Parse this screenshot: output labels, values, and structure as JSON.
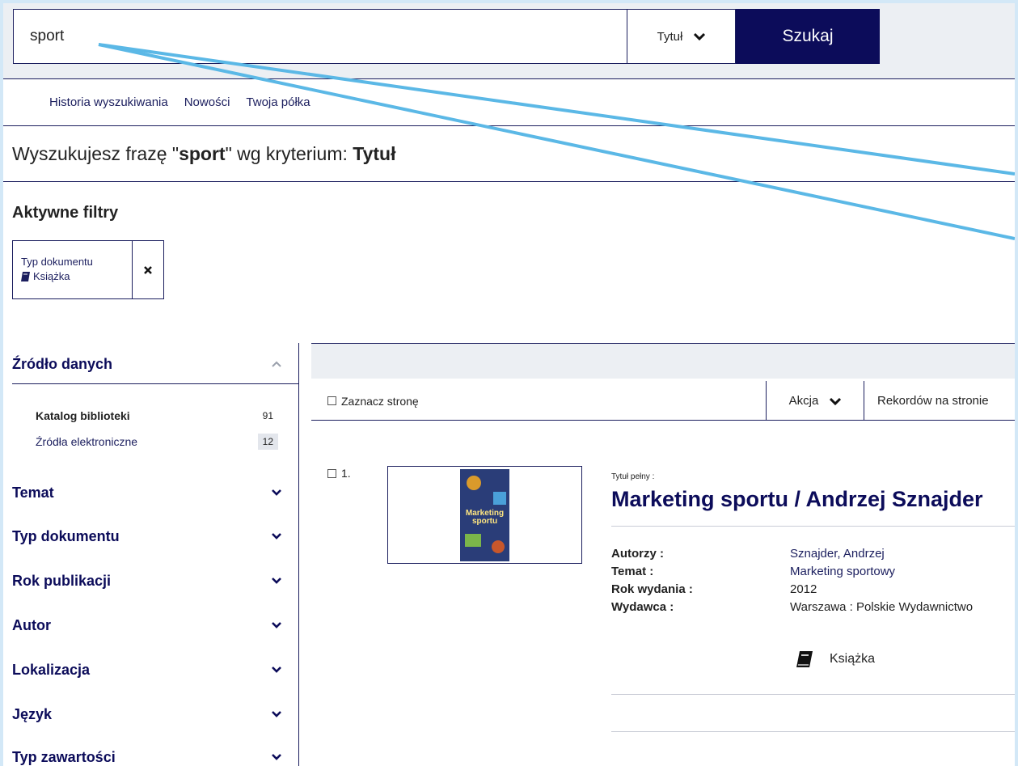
{
  "search": {
    "value": "sport",
    "criterion": "Tytuł",
    "submit_label": "Szukaj"
  },
  "nav": {
    "items": [
      "Historia wyszukiwania",
      "Nowości",
      "Twoja półka"
    ]
  },
  "heading": {
    "prefix": "Wyszukujesz frazę \"",
    "phrase": "sport",
    "middle": "\" wg kryterium: ",
    "criterion": "Tytuł"
  },
  "filters": {
    "title": "Aktywne filtry",
    "chip_label": "Typ dokumentu",
    "chip_value": "Książka"
  },
  "sidebar": {
    "source_title": "Źródło danych",
    "sources": [
      {
        "label": "Katalog biblioteki",
        "count": "91"
      },
      {
        "label": "Źródła elektroniczne",
        "count": "12"
      }
    ],
    "facets": [
      "Temat",
      "Typ dokumentu",
      "Rok publikacji",
      "Autor",
      "Lokalizacja",
      "Język",
      "Typ zawartości"
    ]
  },
  "toolbar": {
    "select_page": "Zaznacz stronę",
    "action": "Akcja",
    "per_page": "Rekordów na stronie"
  },
  "record": {
    "number": "1.",
    "full_title_label": "Tytuł pełny :",
    "title": "Marketing sportu / Andrzej Sznajder",
    "cover_text": "Marketing sportu",
    "fields": [
      {
        "key": "Autorzy :",
        "value": "Sznajder, Andrzej"
      },
      {
        "key": "Temat :",
        "value": "Marketing sportowy"
      },
      {
        "key": "Rok wydania :",
        "value": "2012"
      },
      {
        "key": "Wydawca :",
        "value": "Warszawa : Polskie Wydawnictwo"
      }
    ],
    "doc_type": "Książka"
  },
  "colors": {
    "navy": "#0c0c5a",
    "frame": "#d3e8f7",
    "annotation_line": "#5bb8e6"
  }
}
